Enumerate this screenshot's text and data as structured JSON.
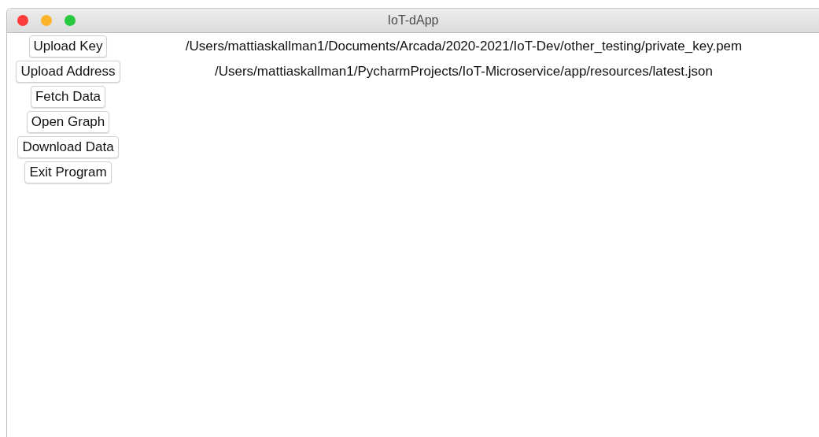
{
  "window": {
    "title": "IoT-dApp"
  },
  "rows": [
    {
      "button": "Upload Key",
      "path": "/Users/mattiaskallman1/Documents/Arcada/2020-2021/IoT-Dev/other_testing/private_key.pem"
    },
    {
      "button": "Upload Address",
      "path": "/Users/mattiaskallman1/PycharmProjects/IoT-Microservice/app/resources/latest.json"
    },
    {
      "button": "Fetch Data"
    },
    {
      "button": "Open Graph"
    },
    {
      "button": "Download Data"
    },
    {
      "button": "Exit Program"
    }
  ]
}
